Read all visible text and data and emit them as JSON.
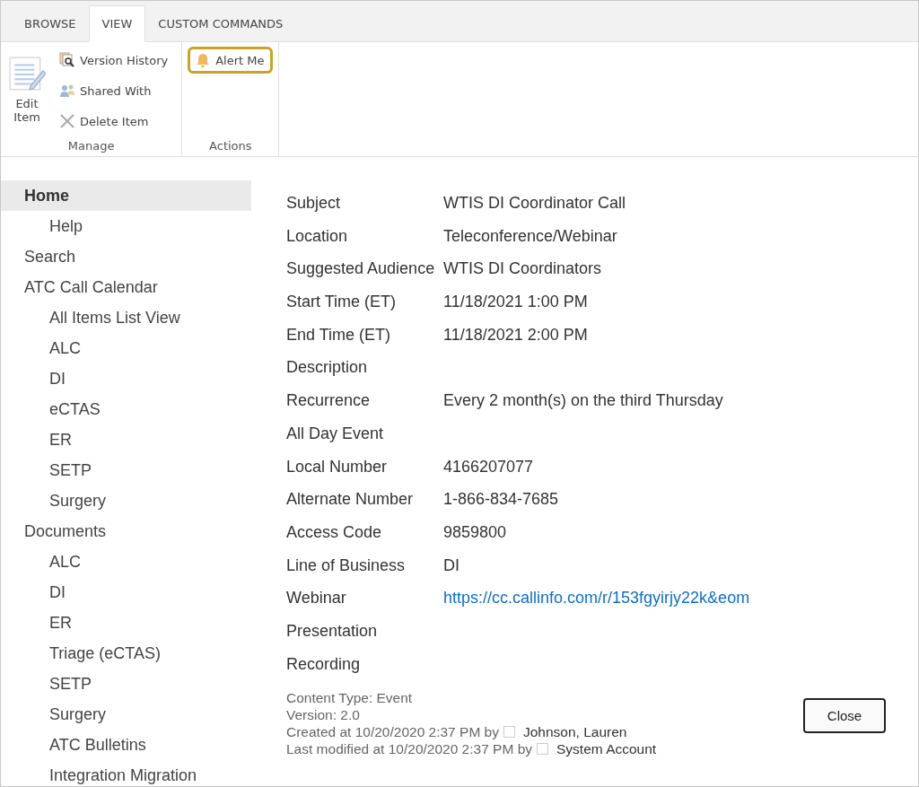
{
  "ribbon": {
    "tabs": [
      {
        "label": "BROWSE",
        "selected": false
      },
      {
        "label": "VIEW",
        "selected": true
      },
      {
        "label": "CUSTOM COMMANDS",
        "selected": false
      }
    ],
    "groups": [
      {
        "label": "Manage",
        "large": {
          "label_lines": [
            "Edit",
            "Item"
          ]
        },
        "items": [
          {
            "label": "Version History",
            "kind": "history"
          },
          {
            "label": "Shared With",
            "kind": "shared"
          },
          {
            "label": "Delete Item",
            "kind": "delete"
          }
        ]
      },
      {
        "label": "Actions",
        "items": [
          {
            "label": "Alert Me",
            "kind": "alert",
            "selected": true
          }
        ]
      }
    ]
  },
  "nav": [
    {
      "label": "Home",
      "selected": true,
      "children": [
        {
          "label": "Help",
          "selected": false
        }
      ]
    },
    {
      "label": "Search",
      "selected": false
    },
    {
      "label": "ATC Call Calendar",
      "selected": false,
      "children": [
        {
          "label": "All Items List View",
          "selected": false
        },
        {
          "label": "ALC",
          "selected": false
        },
        {
          "label": "DI",
          "selected": false
        },
        {
          "label": "eCTAS",
          "selected": false
        },
        {
          "label": "ER",
          "selected": false
        },
        {
          "label": "SETP",
          "selected": false
        },
        {
          "label": "Surgery",
          "selected": false
        }
      ]
    },
    {
      "label": "Documents",
      "selected": false,
      "children": [
        {
          "label": "ALC",
          "selected": false
        },
        {
          "label": "DI",
          "selected": false
        },
        {
          "label": "ER",
          "selected": false
        },
        {
          "label": "Triage (eCTAS)",
          "selected": false
        },
        {
          "label": "SETP",
          "selected": false
        },
        {
          "label": "Surgery",
          "selected": false
        },
        {
          "label": "ATC Bulletins",
          "selected": false
        },
        {
          "label": "Integration Migration",
          "selected": false
        }
      ]
    }
  ],
  "fields": [
    {
      "label": "Subject",
      "value": "WTIS DI Coordinator Call",
      "kind": "text"
    },
    {
      "label": "Location",
      "value": "Teleconference/Webinar",
      "kind": "text"
    },
    {
      "label": "Suggested Audience",
      "value": "WTIS DI Coordinators",
      "kind": "text"
    },
    {
      "label": "Start Time (ET)",
      "value": "11/18/2021 1:00 PM",
      "kind": "text"
    },
    {
      "label": "End Time (ET)",
      "value": "11/18/2021 2:00 PM",
      "kind": "text"
    },
    {
      "label": "Description"
    },
    {
      "label": "Recurrence",
      "value": "Every 2 month(s) on the third Thursday",
      "kind": "text"
    },
    {
      "label": "All Day Event"
    },
    {
      "label": "Local Number",
      "value": "4166207077",
      "kind": "text"
    },
    {
      "label": "Alternate Number",
      "value": "1-866-834-7685",
      "kind": "text"
    },
    {
      "label": "Access Code",
      "value": "9859800",
      "kind": "text"
    },
    {
      "label": "Line of Business",
      "value": "DI",
      "kind": "text"
    },
    {
      "label": "Webinar",
      "value": "https://cc.callinfo.com/r/153fgyirjy22k&eom",
      "kind": "link"
    },
    {
      "label": "Presentation"
    },
    {
      "label": "Recording"
    }
  ],
  "footer": {
    "content_type": "Content Type: Event",
    "version": "Version: 2.0",
    "created": {
      "text": "Created at 10/20/2020 2:37 PM by",
      "user": "Johnson, Lauren"
    },
    "modified": {
      "text": "Last modified at 10/20/2020 2:37 PM by",
      "user": "System Account"
    }
  },
  "close_button": "Close"
}
